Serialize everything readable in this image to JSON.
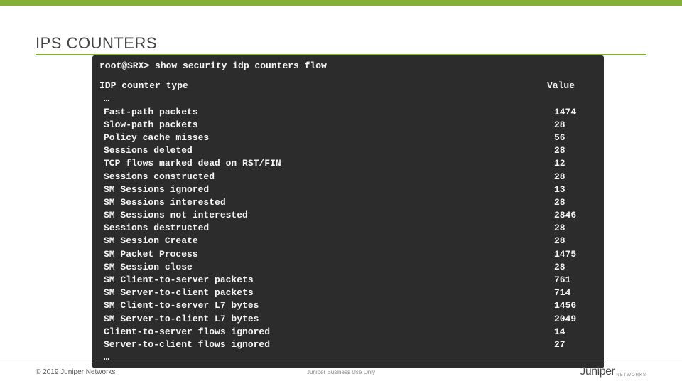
{
  "title": "IPS COUNTERS",
  "terminal": {
    "command": "root@SRX> show security idp counters flow",
    "header_label": "IDP counter type",
    "header_value": "Value",
    "ellipsis": "…",
    "rows": [
      {
        "label": "Fast-path packets",
        "value": "1474"
      },
      {
        "label": "Slow-path packets",
        "value": "28"
      },
      {
        "label": "Policy cache misses",
        "value": "56"
      },
      {
        "label": "Sessions deleted",
        "value": "28"
      },
      {
        "label": "TCP flows marked dead on RST/FIN",
        "value": "12"
      },
      {
        "label": "Sessions constructed",
        "value": "28"
      },
      {
        "label": "SM Sessions ignored",
        "value": "13"
      },
      {
        "label": "SM Sessions interested",
        "value": "28"
      },
      {
        "label": "SM Sessions not interested",
        "value": "2846"
      },
      {
        "label": "Sessions destructed",
        "value": "28"
      },
      {
        "label": "SM Session Create",
        "value": "28"
      },
      {
        "label": "SM Packet Process",
        "value": "1475"
      },
      {
        "label": "SM Session close",
        "value": "28"
      },
      {
        "label": "SM Client-to-server packets",
        "value": "761"
      },
      {
        "label": "SM Server-to-client packets",
        "value": "714"
      },
      {
        "label": "SM Client-to-server L7 bytes",
        "value": "1456"
      },
      {
        "label": "SM Server-to-client L7 bytes",
        "value": "2049"
      },
      {
        "label": "Client-to-server flows ignored",
        "value": "14"
      },
      {
        "label": "Server-to-client flows ignored",
        "value": "27"
      }
    ]
  },
  "footer": {
    "copyright": "© 2019 Juniper Networks",
    "center": "Juniper Business Use Only",
    "logo_text": "Juniper",
    "logo_sub": "NETWORKS"
  }
}
